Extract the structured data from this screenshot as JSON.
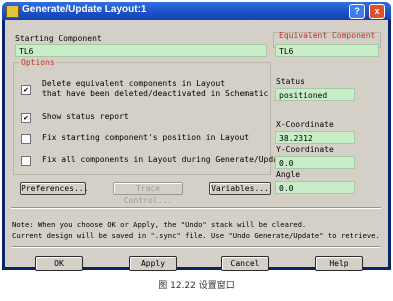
{
  "window": {
    "title": "Generate/Update Layout:1",
    "help_label": "?",
    "close_label": "x"
  },
  "starting_component": {
    "label": "Starting Component",
    "value": "TL6"
  },
  "options": {
    "label": "Options",
    "delete_line1": "Delete equivalent components in Layout",
    "delete_line2": "that have been deleted/deactivated in Schematic",
    "delete_checked": "✔",
    "status_report": "Show status report",
    "status_checked": "✔",
    "fix_start": "Fix starting component's position in Layout",
    "fix_all": "Fix all components in Layout during Generate/Update"
  },
  "equivalent": {
    "label": "Equivalent Component",
    "value": "TL6",
    "status_label": "Status",
    "status_value": "positioned",
    "x_label": "X-Coordinate",
    "x_value": "38.2312",
    "y_label": "Y-Coordinate",
    "y_value": "0.0",
    "angle_label": "Angle",
    "angle_value": "0.0"
  },
  "buttons": {
    "preferences": "Preferences...",
    "trace_control": "Trace Control...",
    "variables": "Variables...",
    "ok": "OK",
    "apply": "Apply",
    "cancel": "Cancel",
    "help": "Help"
  },
  "note": {
    "line1": "Note: When you choose OK or Apply, the \"Undo\" stack will be cleared.",
    "line2": "Current design will be saved in \".sync\" file. Use \"Undo Generate/Update\" to retrieve."
  },
  "caption": "图 12.22  设置窗口"
}
